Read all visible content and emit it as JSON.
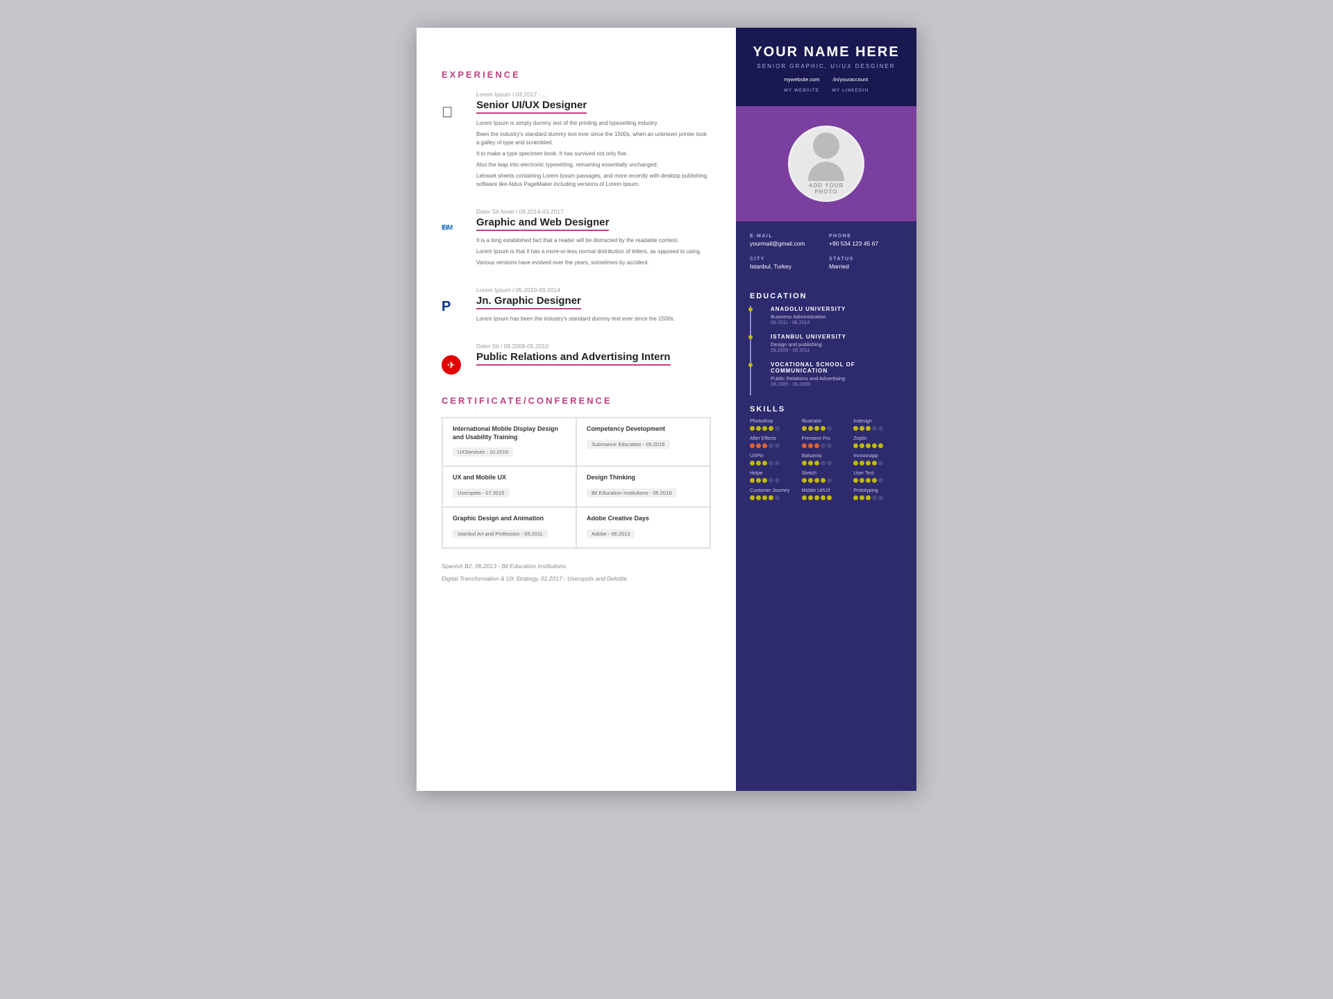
{
  "right": {
    "name": "YOUR NAME HERE",
    "title": "SENIOR GRAPHIC, UI/UX DESGINER",
    "website_url": "mywebsite.com",
    "website_label": "MY WEBSITE",
    "linkedin_url": "/in/youraccount",
    "linkedin_label": "MY LINKEDIN",
    "photo_text_add": "ADD YOUR",
    "photo_text_photo": "PHOTO",
    "email_label": "E-MAIL",
    "email_value": "yourmail@gmail.com",
    "phone_label": "PHONE",
    "phone_value": "+90 534 123 45 67",
    "city_label": "CITY",
    "city_value": "Istanbul, Turkey",
    "status_label": "STATUS",
    "status_value": "Married",
    "education_title": "EDUCATION",
    "education": [
      {
        "school": "ANADOLU UNIVERSITY",
        "degree": "Business Administration",
        "dates": "09.2011 - 06.2014"
      },
      {
        "school": "ISTANBUL UNIVERSITY",
        "degree": "Design and publishing",
        "dates": "09.2009 - 06.2011"
      },
      {
        "school": "VOCATIONAL SCHOOL OF COMMUNICATION",
        "degree": "Public Relations and Advertising",
        "dates": "09.2005 - 06.2009"
      }
    ],
    "skills_title": "SKILLS",
    "skills": [
      {
        "name": "Photoshop",
        "filled": 4,
        "total": 5,
        "color": "yellow"
      },
      {
        "name": "Illustrator",
        "filled": 4,
        "total": 5,
        "color": "yellow"
      },
      {
        "name": "Indesign",
        "filled": 3,
        "total": 5,
        "color": "yellow"
      },
      {
        "name": "After Effects",
        "filled": 3,
        "total": 5,
        "color": "orange"
      },
      {
        "name": "Premiere Pro",
        "filled": 3,
        "total": 5,
        "color": "orange"
      },
      {
        "name": "Zeplin",
        "filled": 5,
        "total": 5,
        "color": "yellow"
      },
      {
        "name": "UXPin",
        "filled": 3,
        "total": 5,
        "color": "yellow"
      },
      {
        "name": "Balsamiq",
        "filled": 3,
        "total": 5,
        "color": "yellow"
      },
      {
        "name": "Invisionapp",
        "filled": 4,
        "total": 5,
        "color": "yellow"
      },
      {
        "name": "Hotjar",
        "filled": 3,
        "total": 5,
        "color": "yellow"
      },
      {
        "name": "Sketch",
        "filled": 4,
        "total": 5,
        "color": "yellow"
      },
      {
        "name": "User Test",
        "filled": 4,
        "total": 5,
        "color": "yellow"
      },
      {
        "name": "Customer Journey",
        "filled": 4,
        "total": 5,
        "color": "yellow"
      },
      {
        "name": "Mobile UI/UX",
        "filled": 5,
        "total": 5,
        "color": "yellow"
      },
      {
        "name": "Prototyping",
        "filled": 3,
        "total": 5,
        "color": "yellow"
      }
    ]
  },
  "left": {
    "experience_title": "EXPERIENCE",
    "experiences": [
      {
        "company": "Lorem Ipsum / 03.2017 - ...",
        "title": "Senior UI/UX Designer",
        "logo_type": "apple",
        "description": [
          "Lorem Ipsum is simply dummy text of the printing and typesetting industry.",
          "Been the industry's standard dummy text ever since the 1500s, when an unknown printer took a galley of type and scrambled.",
          "It to make a type specimen book. It has survived not only five.",
          "Also the leap into electronic typesetting, remaining essentially unchanged.",
          "Letraset sheets containing Lorem Ipsum passages, and more recently with desktop publishing software like Aldus PageMaker including versions of Lorem Ipsum."
        ]
      },
      {
        "company": "Dolor Sit Amet / 09.2014-03.2017",
        "title": "Graphic and Web Designer",
        "logo_type": "ibm",
        "description": [
          "It is a long established fact that a reader will be distracted by the readable content.",
          "Lorem Ipsum is that it has a more-or-less normal distribution of letters, as opposed to using.",
          "Various versions have evolved over the years, sometimes by accident."
        ]
      },
      {
        "company": "Lorem Ipsum / 05.2010-09.2014",
        "title": "Jn. Graphic Designer",
        "logo_type": "paypal",
        "description": [
          "Lorem Ipsum has been the industry's standard dummy text ever since the 1500s."
        ]
      },
      {
        "company": "Dolor Sit / 09.2009-05.2010",
        "title": "Public Relations and Advertising Intern",
        "logo_type": "turkish",
        "description": []
      }
    ],
    "cert_title": "CERTIFICATE/CONFERENCE",
    "certificates": [
      {
        "name": "International Mobile Display Design and Usability Training",
        "badge": "UXServices - 10.2016"
      },
      {
        "name": "Competency Development",
        "badge": "Submarine Education - 05.2016"
      },
      {
        "name": "UX and Mobile UX",
        "badge": "Userspots - 07.2015"
      },
      {
        "name": "Design Thinking",
        "badge": "Bil Education Institutions - 05.2016"
      },
      {
        "name": "Graphic Design and Animation",
        "badge": "Istanbul Art and Profession - 05.2011"
      },
      {
        "name": "Adobe Creative Days",
        "badge": "Adobe - 06.2013"
      }
    ],
    "language_text": "Spanish B2, 06.2013",
    "language_institution": "Bil Education Institutions",
    "digital_text": "Digital Transformation & UX Strategy, 01.2017",
    "digital_institution": "Userspots and Deloitte"
  }
}
